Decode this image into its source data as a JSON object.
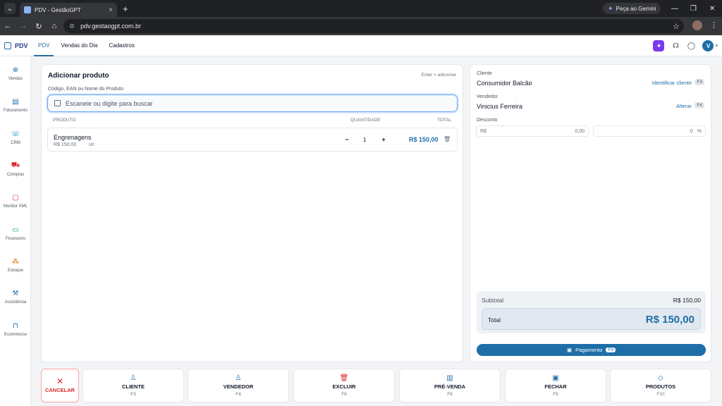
{
  "browser": {
    "tab_title": "PDV - GestãoGPT",
    "tab_close": "×",
    "new_tab": "+",
    "gemini_label": "Peça ao Gemini",
    "url": "pdv.gestaogpt.com.br",
    "win_min": "—",
    "win_max": "❐",
    "win_close": "✕"
  },
  "header": {
    "brand": "PDV",
    "tabs": [
      {
        "label": "PDV",
        "active": true
      },
      {
        "label": "Vendas do Dia",
        "active": false
      },
      {
        "label": "Cadastros",
        "active": false
      }
    ],
    "avatar_initial": "V"
  },
  "sidebar": {
    "items": [
      {
        "label": "Vendas",
        "icon": "basket-icon",
        "color": "#1e6fa8"
      },
      {
        "label": "Faturamento",
        "icon": "document-icon",
        "color": "#1e6fa8"
      },
      {
        "label": "CRM",
        "icon": "chat-icon",
        "color": "#0891b2"
      },
      {
        "label": "Compras",
        "icon": "cart-icon",
        "color": "#dc2626"
      },
      {
        "label": "Monitor XML",
        "icon": "file-icon",
        "color": "#db2777"
      },
      {
        "label": "Financeiro",
        "icon": "money-icon",
        "color": "#16a34a"
      },
      {
        "label": "Estoque",
        "icon": "boxes-icon",
        "color": "#d97706"
      },
      {
        "label": "Assistência",
        "icon": "tools-icon",
        "color": "#1e6fa8"
      },
      {
        "label": "Ecommerce",
        "icon": "bag-icon",
        "color": "#1e6fa8"
      }
    ]
  },
  "main": {
    "title": "Adicionar produto",
    "hint": "Enter = adicionar",
    "search_label": "Código, EAN ou Nome do Produto",
    "search_placeholder": "Escaneie ou digite para buscar",
    "columns": {
      "product": "PRODUTO",
      "quantity": "QUANTIDADE",
      "total": "TOTAL"
    },
    "items": [
      {
        "name": "Engrenagens",
        "price": "R$ 150,00",
        "unit": "un",
        "quantity": "1",
        "total": "R$ 150,00"
      }
    ],
    "minus": "−",
    "plus": "+"
  },
  "side_panel": {
    "client_label": "Cliente",
    "client_value": "Consumidor Balcão",
    "client_link": "Identificar cliente",
    "client_key": "F3",
    "seller_label": "Vendedor",
    "seller_value": "Vinicius Ferreira",
    "seller_link": "Alterar",
    "seller_key": "F4",
    "discount_label": "Desconto",
    "discount_currency": "R$",
    "discount_value": "0,00",
    "discount_percent_value": "0",
    "discount_percent_symbol": "%",
    "subtotal_label": "Subtotal",
    "subtotal_value": "R$ 150,00",
    "total_label": "Total",
    "total_value": "R$ 150,00",
    "payment_label": "Pagamento",
    "payment_key": "F9"
  },
  "actions": [
    {
      "label": "CANCELAR",
      "key": "",
      "icon": "close-icon"
    },
    {
      "label": "CLIENTE",
      "key": "F3",
      "icon": "user-icon"
    },
    {
      "label": "VENDEDOR",
      "key": "F4",
      "icon": "user-check-icon"
    },
    {
      "label": "EXCLUIR",
      "key": "F6",
      "icon": "trash-icon"
    },
    {
      "label": "PRÉ-VENDA",
      "key": "F8",
      "icon": "clipboard-icon"
    },
    {
      "label": "FECHAR",
      "key": "F9",
      "icon": "register-icon"
    },
    {
      "label": "PRODUTOS",
      "key": "F10",
      "icon": "tag-icon"
    }
  ]
}
